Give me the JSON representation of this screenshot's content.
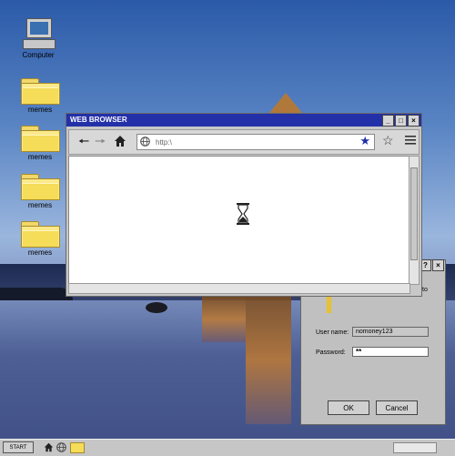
{
  "desktop": {
    "icons": [
      {
        "label": "Computer",
        "icon": "computer-icon"
      },
      {
        "label": "memes",
        "icon": "folder-icon"
      },
      {
        "label": "memes",
        "icon": "folder-icon"
      },
      {
        "label": "memes",
        "icon": "folder-icon"
      },
      {
        "label": "memes",
        "icon": "folder-icon"
      }
    ]
  },
  "browser": {
    "title": "WEB BROWSER",
    "title_buttons": [
      "_",
      "□",
      "×"
    ],
    "url": "http:\\",
    "status": "loading",
    "loading_icon": "hourglass-icon"
  },
  "login_dialog": {
    "title_buttons": [
      "?",
      "×"
    ],
    "partial_text": "to",
    "username_label": "User name:",
    "username_value": "nomoney123",
    "password_label": "Password:",
    "password_value": "**",
    "ok_label": "OK",
    "cancel_label": "Cancel"
  },
  "taskbar": {
    "start_label": "START",
    "quick_launch": [
      "home-icon",
      "globe-icon",
      "folder-icon"
    ]
  },
  "colors": {
    "title_bar": "#2430a8",
    "window_chrome": "#c8c8c8",
    "star_accent": "#1e2fa8",
    "folder_yellow": "#fbe98a"
  }
}
